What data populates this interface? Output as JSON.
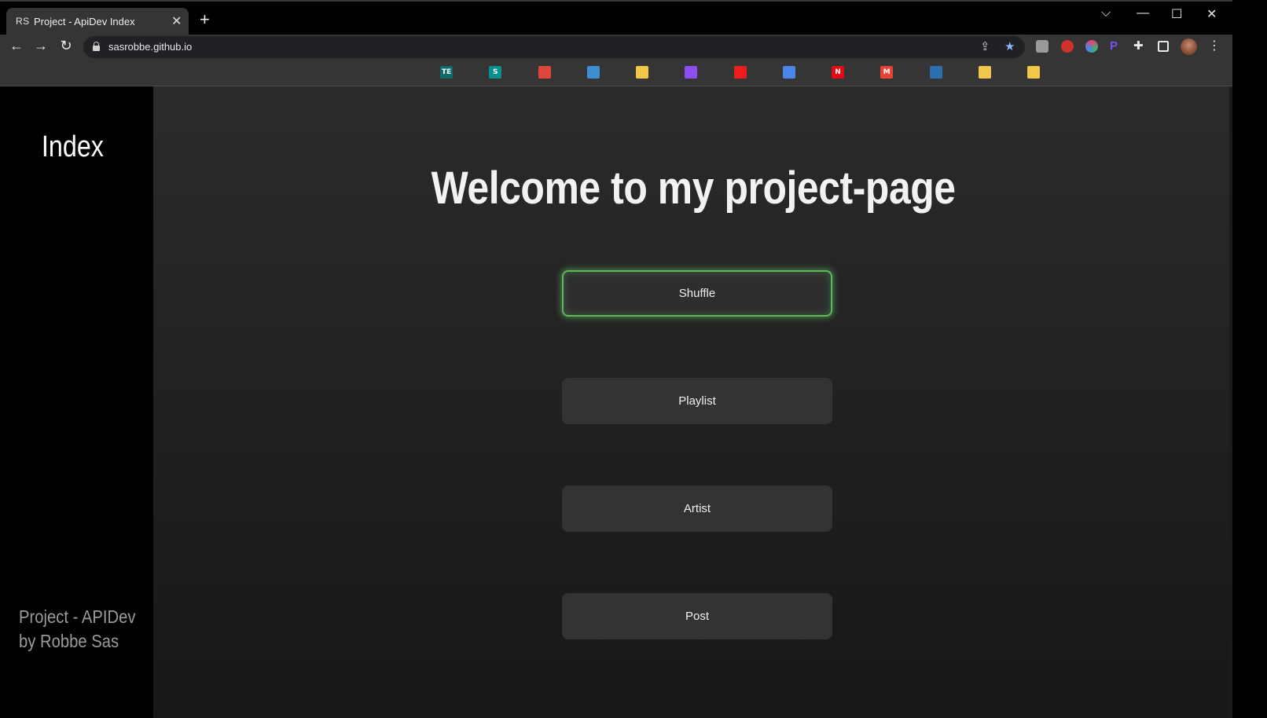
{
  "browser": {
    "tab": {
      "favicon_text": "RS",
      "title": "Project - ApiDev Index",
      "close_glyph": "✕"
    },
    "new_tab_glyph": "+",
    "window_controls": {
      "dropdown": "⌵",
      "minimize": "—",
      "maximize": "☐",
      "close": "✕"
    },
    "nav": {
      "back": "←",
      "forward": "→",
      "reload": "↻"
    },
    "url": "sasrobbe.github.io",
    "omnibox_icons": [
      "share-icon",
      "bookmark-star-icon"
    ],
    "extensions": [
      "ext-k-icon",
      "ext-red-icon",
      "ext-multicolor-icon",
      "ext-p-icon",
      "extensions-puzzle-icon",
      "side-panel-icon"
    ],
    "menu_glyph": "⋮",
    "bookmarks": [
      {
        "icon": "te-icon",
        "text": "TE",
        "color": "#0f6b6b"
      },
      {
        "icon": "sharepoint-icon",
        "text": "S",
        "color": "#0a8f8f"
      },
      {
        "icon": "circle-dots-icon",
        "text": "",
        "color": "#e0463b"
      },
      {
        "icon": "cisco-icon",
        "text": "",
        "color": "#3d8fd1"
      },
      {
        "icon": "sticky-note-icon",
        "text": "",
        "color": "#f2c84b"
      },
      {
        "icon": "twitch-icon",
        "text": "",
        "color": "#8e4ff0"
      },
      {
        "icon": "youtube-icon",
        "text": "",
        "color": "#ee1c1c"
      },
      {
        "icon": "translate-icon",
        "text": "",
        "color": "#4a86e8"
      },
      {
        "icon": "netflix-icon",
        "text": "N",
        "color": "#e50914"
      },
      {
        "icon": "gmail-icon",
        "text": "M",
        "color": "#ea4335"
      },
      {
        "icon": "steam-icon",
        "text": "",
        "color": "#2a6fae"
      },
      {
        "icon": "sticky-note-icon",
        "text": "",
        "color": "#f2c84b"
      },
      {
        "icon": "sticky-note-icon",
        "text": "",
        "color": "#f2c84b"
      }
    ]
  },
  "sidebar": {
    "title": "Index",
    "footer_line1": "Project - APIDev",
    "footer_line2": "by Robbe Sas"
  },
  "main": {
    "title": "Welcome to my project-page",
    "buttons": [
      {
        "label": "Shuffle",
        "active": true
      },
      {
        "label": "Playlist",
        "active": false
      },
      {
        "label": "Artist",
        "active": false
      },
      {
        "label": "Post",
        "active": false
      }
    ]
  },
  "colors": {
    "accent_glow": "#5fb85c",
    "sidebar_bg": "#000000",
    "button_bg": "#333333"
  }
}
